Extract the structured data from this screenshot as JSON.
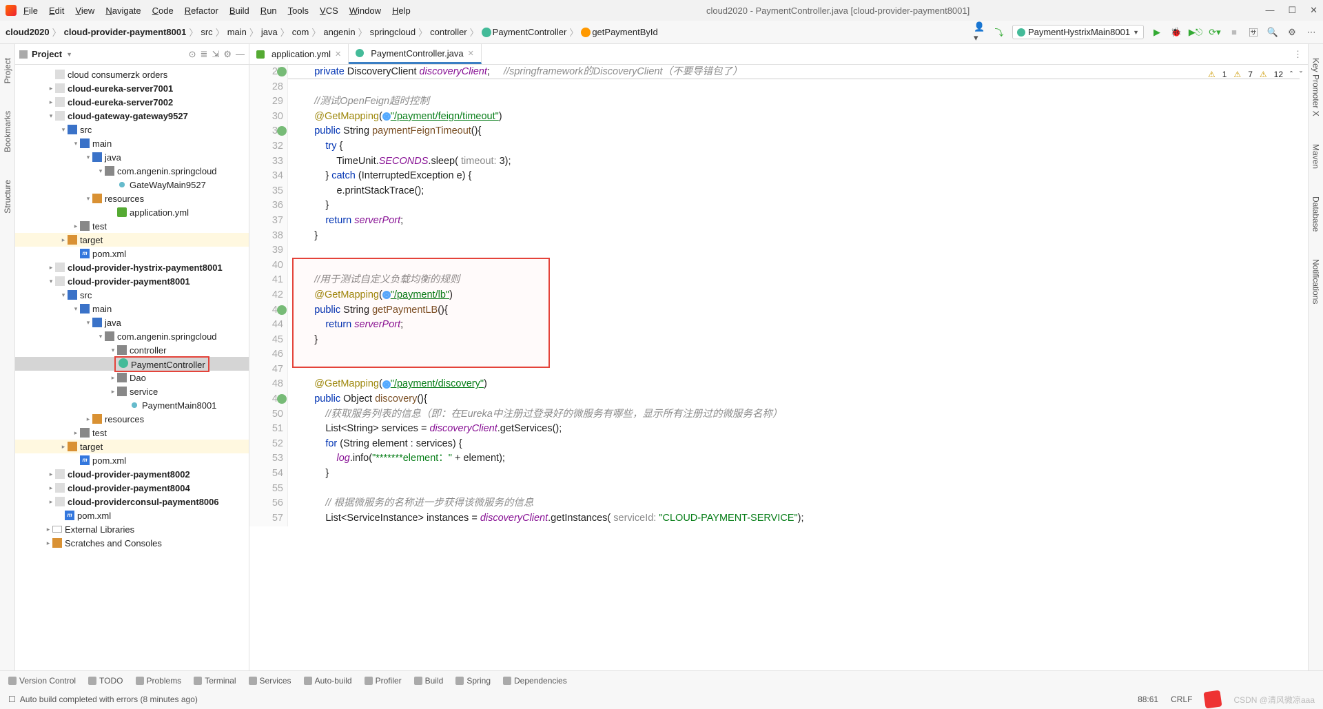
{
  "window": {
    "title": "cloud2020 - PaymentController.java [cloud-provider-payment8001]",
    "menu": [
      "File",
      "Edit",
      "View",
      "Navigate",
      "Code",
      "Refactor",
      "Build",
      "Run",
      "Tools",
      "VCS",
      "Window",
      "Help"
    ]
  },
  "breadcrumbs": {
    "items": [
      "cloud2020",
      "cloud-provider-payment8001",
      "src",
      "main",
      "java",
      "com",
      "angenin",
      "springcloud",
      "controller",
      "PaymentController",
      "getPaymentById"
    ]
  },
  "run": {
    "config": "PaymentHystrixMain8001"
  },
  "project": {
    "title": "Project",
    "tree": [
      {
        "pad": 46,
        "arrow": "",
        "icon": "i-mod",
        "label": "cloud consumerzk orders",
        "extra": ""
      },
      {
        "pad": 46,
        "arrow": ">",
        "icon": "i-mod",
        "label": "cloud-eureka-server7001",
        "bold": true
      },
      {
        "pad": 46,
        "arrow": ">",
        "icon": "i-mod",
        "label": "cloud-eureka-server7002",
        "bold": true
      },
      {
        "pad": 46,
        "arrow": "v",
        "icon": "i-mod",
        "label": "cloud-gateway-gateway9527",
        "bold": true
      },
      {
        "pad": 64,
        "arrow": "v",
        "icon": "i-fold-b",
        "label": "src"
      },
      {
        "pad": 82,
        "arrow": "v",
        "icon": "i-fold-b",
        "label": "main"
      },
      {
        "pad": 100,
        "arrow": "v",
        "icon": "i-fold-b",
        "label": "java"
      },
      {
        "pad": 118,
        "arrow": "v",
        "icon": "i-fold",
        "label": "com.angenin.springcloud"
      },
      {
        "pad": 136,
        "arrow": "",
        "icon": "i-java",
        "label": "GateWayMain9527"
      },
      {
        "pad": 100,
        "arrow": "v",
        "icon": "i-fold-o",
        "label": "resources"
      },
      {
        "pad": 136,
        "arrow": "",
        "icon": "i-yml",
        "label": "application.yml"
      },
      {
        "pad": 82,
        "arrow": ">",
        "icon": "i-fold",
        "label": "test"
      },
      {
        "pad": 64,
        "arrow": ">",
        "icon": "i-fold-o",
        "label": "target",
        "hl": true
      },
      {
        "pad": 82,
        "arrow": "",
        "icon": "i-xml",
        "label": "pom.xml",
        "iconText": "m"
      },
      {
        "pad": 46,
        "arrow": ">",
        "icon": "i-mod",
        "label": "cloud-provider-hystrix-payment8001",
        "bold": true
      },
      {
        "pad": 46,
        "arrow": "v",
        "icon": "i-mod",
        "label": "cloud-provider-payment8001",
        "bold": true
      },
      {
        "pad": 64,
        "arrow": "v",
        "icon": "i-fold-b",
        "label": "src"
      },
      {
        "pad": 82,
        "arrow": "v",
        "icon": "i-fold-b",
        "label": "main"
      },
      {
        "pad": 100,
        "arrow": "v",
        "icon": "i-fold-b",
        "label": "java"
      },
      {
        "pad": 118,
        "arrow": "v",
        "icon": "i-fold",
        "label": "com.angenin.springcloud"
      },
      {
        "pad": 136,
        "arrow": "v",
        "icon": "i-fold",
        "label": "controller"
      },
      {
        "pad": 154,
        "arrow": "",
        "icon": "i-c",
        "label": "PaymentController",
        "sel": true,
        "box": true
      },
      {
        "pad": 136,
        "arrow": ">",
        "icon": "i-fold",
        "label": "Dao"
      },
      {
        "pad": 136,
        "arrow": ">",
        "icon": "i-fold",
        "label": "service"
      },
      {
        "pad": 154,
        "arrow": "",
        "icon": "i-java",
        "label": "PaymentMain8001"
      },
      {
        "pad": 100,
        "arrow": ">",
        "icon": "i-fold-o",
        "label": "resources"
      },
      {
        "pad": 82,
        "arrow": ">",
        "icon": "i-fold",
        "label": "test"
      },
      {
        "pad": 64,
        "arrow": ">",
        "icon": "i-fold-o",
        "label": "target",
        "hl": true
      },
      {
        "pad": 82,
        "arrow": "",
        "icon": "i-xml",
        "label": "pom.xml",
        "iconText": "m"
      },
      {
        "pad": 46,
        "arrow": ">",
        "icon": "i-mod",
        "label": "cloud-provider-payment8002",
        "bold": true
      },
      {
        "pad": 46,
        "arrow": ">",
        "icon": "i-mod",
        "label": "cloud-provider-payment8004",
        "bold": true
      },
      {
        "pad": 46,
        "arrow": ">",
        "icon": "i-mod",
        "label": "cloud-providerconsul-payment8006",
        "bold": true
      },
      {
        "pad": 60,
        "arrow": "",
        "icon": "i-xml",
        "label": "pom.xml",
        "iconText": "m"
      },
      {
        "pad": 42,
        "arrow": ">",
        "icon": "i-lib",
        "label": "External Libraries"
      },
      {
        "pad": 42,
        "arrow": ">",
        "icon": "i-fold-o",
        "label": "Scratches and Consoles"
      }
    ]
  },
  "tabs": {
    "items": [
      {
        "icon": "i-yml",
        "label": "application.yml",
        "active": false
      },
      {
        "icon": "i-c",
        "label": "PaymentController.java",
        "active": true
      }
    ]
  },
  "warnings": {
    "a": "1",
    "b": "7",
    "c": "12"
  },
  "code": {
    "firstLine": 27,
    "lines": [
      {
        "n": 27,
        "mark": true,
        "html": "        <span class='kw'>private</span> DiscoveryClient <span class='fld'>discoveryClient</span>;     <span class='com'>//springframework的DiscoveryClient（不要导错包了）</span>"
      },
      {
        "n": 28,
        "html": ""
      },
      {
        "n": 29,
        "html": "        <span class='com'>//测试OpenFeign超时控制</span>"
      },
      {
        "n": 30,
        "html": "        <span class='ann'>@GetMapping</span>(<span class='ic-web'></span><span class='url'>\"/payment/feign/timeout\"</span>)"
      },
      {
        "n": 31,
        "mark": true,
        "html": "        <span class='kw'>public</span> String <span class='mtd'>paymentFeignTimeout</span>(){"
      },
      {
        "n": 32,
        "html": "            <span class='kw'>try</span> {"
      },
      {
        "n": 33,
        "html": "                TimeUnit.<span class='fld'>SECONDS</span>.sleep( <span class='param'>timeout:</span> 3);"
      },
      {
        "n": 34,
        "html": "            } <span class='kw'>catch</span> (InterruptedException e) {"
      },
      {
        "n": 35,
        "html": "                e.printStackTrace();"
      },
      {
        "n": 36,
        "html": "            }"
      },
      {
        "n": 37,
        "html": "            <span class='kw'>return</span> <span class='fld'>serverPort</span>;"
      },
      {
        "n": 38,
        "html": "        }"
      },
      {
        "n": 39,
        "html": ""
      },
      {
        "n": 40,
        "html": ""
      },
      {
        "n": 41,
        "html": "        <span class='com'>//用于测试自定义负载均衡的规则</span>"
      },
      {
        "n": 42,
        "html": "        <span class='ann'>@GetMapping</span>(<span class='ic-web'></span><span class='url'>\"/payment/lb\"</span>)"
      },
      {
        "n": 43,
        "mark": true,
        "html": "        <span class='kw'>public</span> String <span class='mtd'>getPaymentLB</span>(){"
      },
      {
        "n": 44,
        "html": "            <span class='kw'>return</span> <span class='fld'>serverPort</span>;"
      },
      {
        "n": 45,
        "html": "        }"
      },
      {
        "n": 46,
        "html": ""
      },
      {
        "n": 47,
        "html": ""
      },
      {
        "n": 48,
        "html": "        <span class='ann'>@GetMapping</span>(<span class='ic-web'></span><span class='url'>\"/payment/discovery\"</span>)"
      },
      {
        "n": 49,
        "mark": true,
        "html": "        <span class='kw'>public</span> Object <span class='mtd'>discovery</span>(){"
      },
      {
        "n": 50,
        "html": "            <span class='com'>//获取服务列表的信息（即：在Eureka中注册过登录好的微服务有哪些，显示所有注册过的微服务名称）</span>"
      },
      {
        "n": 51,
        "html": "            List&lt;String&gt; services = <span class='fld'>discoveryClient</span>.getServices();"
      },
      {
        "n": 52,
        "html": "            <span class='kw'>for</span> (String element : services) {"
      },
      {
        "n": 53,
        "html": "                <span class='fld'>log</span>.info(<span class='str'>\"*******element：\"</span> + element);"
      },
      {
        "n": 54,
        "html": "            }"
      },
      {
        "n": 55,
        "html": ""
      },
      {
        "n": 56,
        "html": "            <span class='com'>// 根据微服务的名称进一步获得该微服务的信息</span>"
      },
      {
        "n": 57,
        "html": "            List&lt;ServiceInstance&gt; instances = <span class='fld'>discoveryClient</span>.getInstances( <span class='param'>serviceId:</span> <span class='str'>\"CLOUD-PAYMENT-SERVICE\"</span>);"
      }
    ]
  },
  "bottom": {
    "items": [
      "Version Control",
      "TODO",
      "Problems",
      "Terminal",
      "Services",
      "Auto-build",
      "Profiler",
      "Build",
      "Spring",
      "Dependencies"
    ]
  },
  "status": {
    "msg": "Auto build completed with errors (8 minutes ago)",
    "pos": "88:61",
    "crlf": "CRLF",
    "watermark": "CSDN @清风微凉aaa"
  },
  "leftStrip": [
    "Project",
    "Bookmarks",
    "Structure"
  ],
  "rightStrip": [
    "Key Promoter X",
    "Maven",
    "Database",
    "Notifications"
  ]
}
